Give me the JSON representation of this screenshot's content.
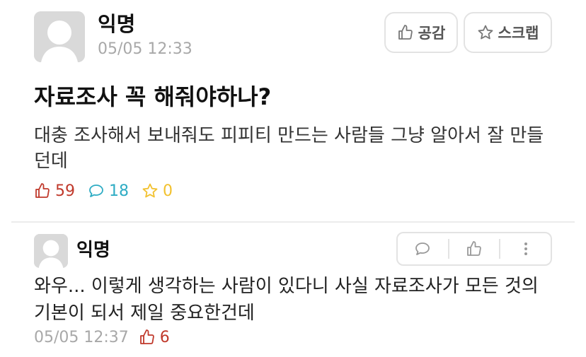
{
  "post": {
    "author": "익명",
    "time": "05/05 12:33",
    "like_button_label": "공감",
    "scrap_button_label": "스크랩",
    "title": "자료조사 꼭 해줘야하나?",
    "body": "대충 조사해서 보내줘도 피피티 만드는 사람들 그냥 알아서 잘 만들던데",
    "stats": {
      "likes": "59",
      "comments": "18",
      "scraps": "0"
    },
    "colors": {
      "like": "#c0392b",
      "comment": "#2eacc4",
      "scrap": "#f2c12e"
    },
    "icons": {
      "avatar": "default-avatar-icon",
      "like": "thumbs-up-icon",
      "scrap": "star-icon",
      "comment": "speech-bubble-icon"
    }
  },
  "comment": {
    "author": "익명",
    "body": "와우... 이렇게 생각하는 사람이 있다니 사실 자료조사가 모든 것의 기본이 되서 제일 중요한건데",
    "time": "05/05 12:37",
    "likes": "6",
    "icons": {
      "reply": "speech-bubble-icon",
      "like": "thumbs-up-icon",
      "more": "more-vertical-icon"
    }
  }
}
